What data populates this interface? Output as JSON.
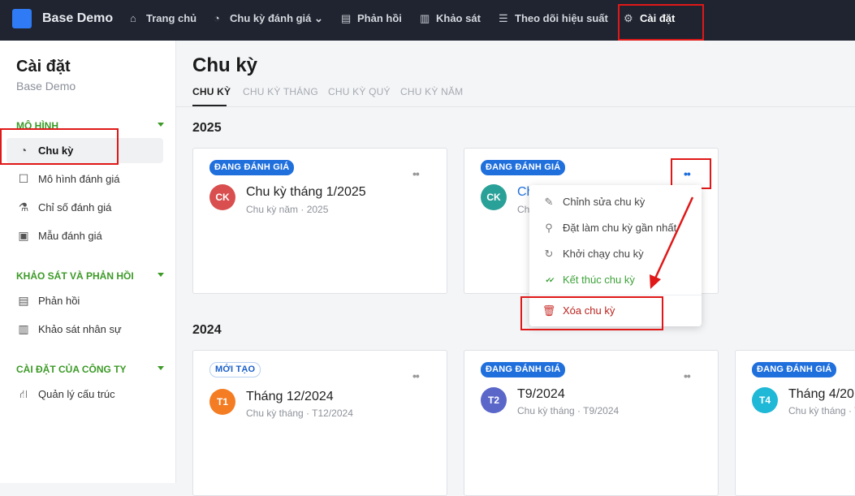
{
  "app": {
    "name": "Base Demo"
  },
  "topnav": [
    {
      "label": "Trang chủ",
      "icon": "home-icon",
      "glyph": "⌂"
    },
    {
      "label": "Chu kỳ đánh giá",
      "icon": "cycle-icon",
      "glyph": "◔",
      "dropdown": "⌄"
    },
    {
      "label": "Phản hồi",
      "icon": "feedback-icon",
      "glyph": "▤"
    },
    {
      "label": "Khảo sát",
      "icon": "survey-chart-icon",
      "glyph": "▥"
    },
    {
      "label": "Theo dõi hiệu suất",
      "icon": "performance-icon",
      "glyph": "☰"
    },
    {
      "label": "Cài đặt",
      "icon": "gear-icon",
      "glyph": "⚙"
    }
  ],
  "sidebar": {
    "title": "Cài đặt",
    "subtitle": "Base Demo",
    "sections": [
      {
        "label": "MÔ HÌNH",
        "items": [
          {
            "label": "Chu kỳ",
            "icon": "cycle-icon",
            "glyph": "◔",
            "active": true
          },
          {
            "label": "Mô hình đánh giá",
            "icon": "model-icon",
            "glyph": "☐"
          },
          {
            "label": "Chỉ số đánh giá",
            "icon": "metrics-icon",
            "glyph": "⚗"
          },
          {
            "label": "Mẫu đánh giá",
            "icon": "template-icon",
            "glyph": "▣"
          }
        ]
      },
      {
        "label": "KHẢO SÁT VÀ PHẢN HỒI",
        "items": [
          {
            "label": "Phản hồi",
            "icon": "feedback-icon",
            "glyph": "▤"
          },
          {
            "label": "Khảo sát nhân sự",
            "icon": "survey-chart-icon",
            "glyph": "▥"
          }
        ]
      },
      {
        "label": "CÀI ĐẶT CỦA CÔNG TY",
        "items": [
          {
            "label": "Quản lý cấu trúc",
            "icon": "org-structure-icon",
            "glyph": "⛙"
          }
        ]
      }
    ]
  },
  "main": {
    "title": "Chu kỳ",
    "tabs": [
      "CHU KỲ",
      "CHU KỲ THÁNG",
      "CHU KỲ QUÝ",
      "CHU KỲ NĂM"
    ]
  },
  "groups": [
    {
      "year": "2025",
      "cards": [
        {
          "badge": "ĐANG ĐÁNH GIÁ",
          "avatar": "CK",
          "avatar_color": "#d94f4f",
          "title": "Chu kỳ tháng 1/2025",
          "subtitle": "Chu kỳ năm · 2025"
        },
        {
          "badge": "ĐANG ĐÁNH GIÁ",
          "avatar": "CK",
          "avatar_color": "#2aa198",
          "title": "Ch",
          "subtitle": "Ch"
        }
      ]
    },
    {
      "year": "2024",
      "cards": [
        {
          "badge": "MỚI TẠO",
          "avatar": "T1",
          "avatar_color": "#f47c22",
          "title": "Tháng 12/2024",
          "subtitle": "Chu kỳ tháng · T12/2024"
        },
        {
          "badge": "ĐANG ĐÁNH GIÁ",
          "avatar": "T2",
          "avatar_color": "#5a67c9",
          "title": "T9/2024",
          "subtitle": "Chu kỳ tháng · T9/2024"
        },
        {
          "badge": "ĐANG ĐÁNH GIÁ",
          "avatar": "T4",
          "avatar_color": "#1fb8d6",
          "title": "Tháng 4/20",
          "subtitle": "Chu kỳ tháng · T"
        }
      ]
    }
  ],
  "more_glyph": "••",
  "context_menu": [
    {
      "label": "Chỉnh sửa chu kỳ",
      "icon": "edit-icon",
      "glyph": "✎"
    },
    {
      "label": "Đặt làm chu kỳ gần nhất",
      "icon": "pin-icon",
      "glyph": "⚲"
    },
    {
      "label": "Khởi chạy chu kỳ",
      "icon": "restart-icon",
      "glyph": "↻"
    },
    {
      "label": "Kết thúc chu kỳ",
      "icon": "double-check-icon",
      "glyph": "✔✔"
    },
    {
      "label": "Xóa chu kỳ",
      "icon": "trash-icon",
      "glyph": "🗑"
    }
  ],
  "colors": {
    "accent": "#1f6fdc",
    "section": "#3c9a27",
    "danger": "#b9231f",
    "topbar": "#1f2430"
  }
}
